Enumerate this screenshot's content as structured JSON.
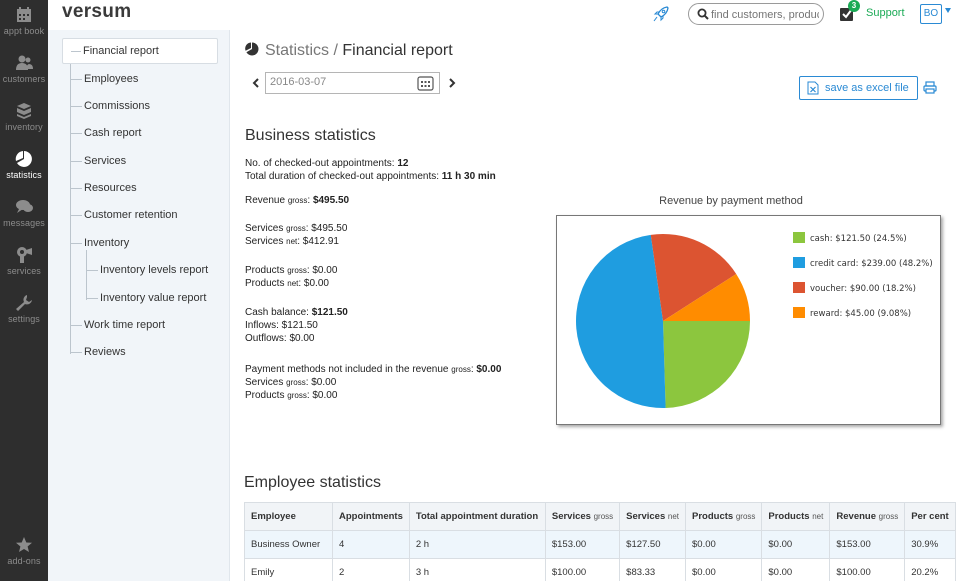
{
  "app": {
    "logo": "versum"
  },
  "leftbar": {
    "items": [
      {
        "id": "appt",
        "label": "appt book",
        "icon": "calendar-icon"
      },
      {
        "id": "customers",
        "label": "customers",
        "icon": "people-icon"
      },
      {
        "id": "inventory",
        "label": "inventory",
        "icon": "boxes-icon"
      },
      {
        "id": "statistics",
        "label": "statistics",
        "icon": "pie-chart-icon",
        "active": true
      },
      {
        "id": "messages",
        "label": "messages",
        "icon": "speech-bubbles-icon"
      },
      {
        "id": "services",
        "label": "services",
        "icon": "hairdryer-icon"
      },
      {
        "id": "settings",
        "label": "settings",
        "icon": "wrench-icon"
      },
      {
        "id": "addons",
        "label": "add-ons",
        "icon": "star-icon"
      }
    ]
  },
  "header": {
    "search_placeholder": "find customers, produc",
    "tasks_badge": "3",
    "support_label": "Support",
    "user_initials": "BO"
  },
  "subnav": {
    "items": [
      "Financial report",
      "Employees",
      "Commissions",
      "Cash report",
      "Services",
      "Resources",
      "Customer retention",
      "Inventory",
      "Inventory levels report",
      "Inventory value report",
      "Work time report",
      "Reviews"
    ]
  },
  "page": {
    "section": "Statistics",
    "separator": " / ",
    "title": "Financial report",
    "date_value": "2016-03-07",
    "excel_label": "save as excel file"
  },
  "business": {
    "title": "Business statistics",
    "appts_label": "No. of checked-out appointments: ",
    "appts_value": "12",
    "duration_label": "Total duration of checked-out appointments: ",
    "duration_value": "11 h 30 min",
    "revenue_label": "Revenue ",
    "revenue_small": "gross",
    "revenue_sep": ": ",
    "revenue_value": "$495.50",
    "services_gross_label": "Services ",
    "services_gross_small": "gross",
    "services_gross_value": ": $495.50",
    "services_net_label": "Services ",
    "services_net_small": "net",
    "services_net_value": ": $412.91",
    "products_gross_label": "Products ",
    "products_gross_small": "gross",
    "products_gross_value": ": $0.00",
    "products_net_label": "Products ",
    "products_net_small": "net",
    "products_net_value": ": $0.00",
    "cash_label": "Cash balance: ",
    "cash_value": "$121.50",
    "inflows": "Inflows: $121.50",
    "outflows": "Outflows: $0.00",
    "notincl_label": "Payment methods not included in the revenue ",
    "notincl_small": "gross",
    "notincl_sep": ": ",
    "notincl_value": "$0.00",
    "ni_services_label": "Services ",
    "ni_services_small": "gross",
    "ni_services_value": ": $0.00",
    "ni_products_label": "Products ",
    "ni_products_small": "gross",
    "ni_products_value": ": $0.00"
  },
  "chart_data": {
    "type": "pie",
    "title": "Revenue by payment method",
    "slices": [
      {
        "label": "cash: $121.50 (24.5%)",
        "name": "cash",
        "value": 121.5,
        "percent": 24.5,
        "color": "#8cc63e"
      },
      {
        "label": "credit card: $239.00 (48.2%)",
        "name": "credit card",
        "value": 239.0,
        "percent": 48.2,
        "color": "#1f9de0"
      },
      {
        "label": "voucher: $90.00 (18.2%)",
        "name": "voucher",
        "value": 90.0,
        "percent": 18.2,
        "color": "#dc5431"
      },
      {
        "label": "reward: $45.00 (9.08%)",
        "name": "reward",
        "value": 45.0,
        "percent": 9.08,
        "color": "#ff8c00"
      }
    ],
    "legend": "top-right"
  },
  "employees": {
    "title": "Employee statistics",
    "columns": [
      {
        "label": "Employee",
        "small": ""
      },
      {
        "label": "Appointments",
        "small": ""
      },
      {
        "label": "Total appointment duration",
        "small": ""
      },
      {
        "label": "Services ",
        "small": "gross"
      },
      {
        "label": "Services ",
        "small": "net"
      },
      {
        "label": "Products ",
        "small": "gross"
      },
      {
        "label": "Products ",
        "small": "net"
      },
      {
        "label": "Revenue ",
        "small": "gross"
      },
      {
        "label": "Per cent",
        "small": ""
      }
    ],
    "rows": [
      [
        "Business Owner",
        "4",
        "2 h",
        "$153.00",
        "$127.50",
        "$0.00",
        "$0.00",
        "$153.00",
        "30.9%"
      ],
      [
        "Emily",
        "2",
        "3 h",
        "$100.00",
        "$83.33",
        "$0.00",
        "$0.00",
        "$100.00",
        "20.2%"
      ]
    ]
  }
}
